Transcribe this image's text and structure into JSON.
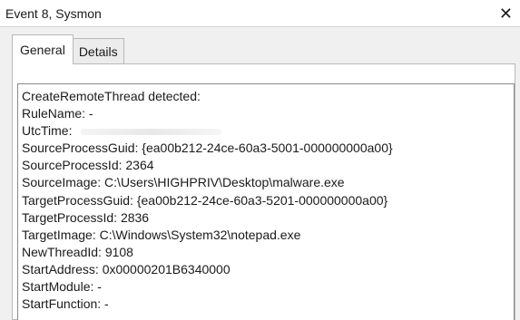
{
  "window": {
    "title": "Event 8, Sysmon",
    "close_glyph": "✕"
  },
  "tabs": [
    {
      "label": "General",
      "selected": true
    },
    {
      "label": "Details",
      "selected": false
    }
  ],
  "event_text": [
    "CreateRemoteThread detected:",
    "RuleName: -",
    "UtcTime:",
    "SourceProcessGuid: {ea00b212-24ce-60a3-5001-000000000a00}",
    "SourceProcessId: 2364",
    "SourceImage: C:\\Users\\HIGHPRIV\\Desktop\\malware.exe",
    "TargetProcessGuid: {ea00b212-24ce-60a3-5201-000000000a00}",
    "TargetProcessId: 2836",
    "TargetImage: C:\\Windows\\System32\\notepad.exe",
    "NewThreadId: 9108",
    "StartAddress: 0x00000201B6340000",
    "StartModule: -",
    "StartFunction: -"
  ]
}
